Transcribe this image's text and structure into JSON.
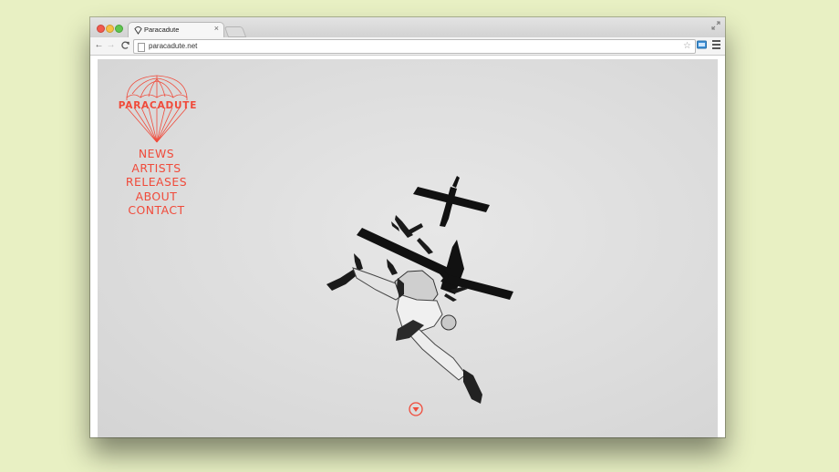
{
  "browser": {
    "tab_title": "Paracadute",
    "tab_close": "×",
    "url": "paracadute.net"
  },
  "site": {
    "logo_text": "PARACADUTE",
    "nav": [
      "NEWS",
      "ARTISTS",
      "RELEASES",
      "ABOUT",
      "CONTACT"
    ]
  },
  "colors": {
    "accent": "#f04a3a",
    "background": "#e8f0c3"
  },
  "icons": {
    "back": "back-arrow-icon",
    "forward": "forward-arrow-icon",
    "reload": "reload-icon",
    "star": "bookmark-star-icon",
    "menu": "hamburger-menu-icon",
    "scroll": "scroll-down-icon"
  }
}
